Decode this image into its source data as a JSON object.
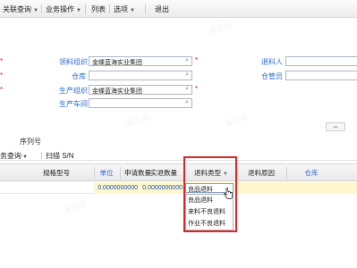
{
  "toolbar": {
    "items": [
      {
        "label": "关联查询",
        "has_menu": true
      },
      {
        "label": "业务操作",
        "has_menu": true
      },
      {
        "label": "列表",
        "has_menu": false
      },
      {
        "label": "选项",
        "has_menu": true
      },
      {
        "label": "退出",
        "has_menu": false
      }
    ]
  },
  "form": {
    "issuing_org": {
      "label": "领料组织",
      "value": "金蝶蓝海实业集团",
      "required": true
    },
    "warehouse": {
      "label": "仓库",
      "value": "",
      "required": false
    },
    "production_org": {
      "label": "生产组织",
      "value": "金蝶蓝海实业集团",
      "required": true
    },
    "production_workshop": {
      "label": "生产车间",
      "value": "",
      "required": false
    },
    "picker": {
      "label": "退料人",
      "value": ""
    },
    "warehouse_keeper": {
      "label": "仓管员",
      "value": ""
    },
    "collapse_symbol": "︽"
  },
  "section": {
    "title": "序列号"
  },
  "sub_toolbar": {
    "items": [
      {
        "label": "务查询",
        "has_menu": true
      },
      {
        "label": "扫描 S/N",
        "has_menu": false
      }
    ]
  },
  "grid": {
    "columns": [
      {
        "label": "规格型号",
        "link": false
      },
      {
        "label": "单位",
        "link": true
      },
      {
        "label": "申请数量",
        "link": false
      },
      {
        "label": "实退数量",
        "link": false
      },
      {
        "label": "退料类型",
        "link": false
      },
      {
        "label": "退料原因",
        "link": false
      },
      {
        "label": "仓库",
        "link": true
      }
    ],
    "row": {
      "apply_qty": "0.0000000000",
      "actual_qty": "0.0000000000"
    }
  },
  "dropdown": {
    "selected": "良品退料",
    "options": [
      "良品退料",
      "来料不良退料",
      "作业不良退料"
    ]
  },
  "watermark": "演示版",
  "colors": {
    "link": "#2a6fd0",
    "required": "#e02020",
    "highlight_row": "#fff8cf",
    "frame": "#d62828"
  }
}
